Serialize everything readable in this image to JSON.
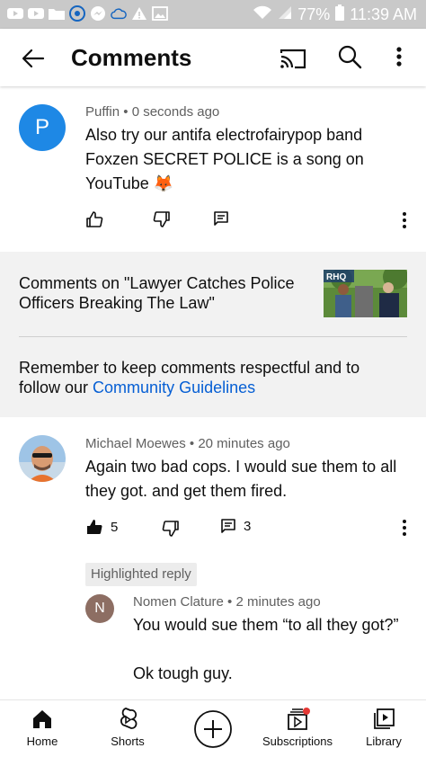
{
  "status_bar": {
    "battery": "77%",
    "time": "11:39 AM"
  },
  "app_bar": {
    "title": "Comments",
    "icons": [
      "back-arrow-icon",
      "cast-icon",
      "search-icon",
      "more-vert-icon"
    ]
  },
  "comments": [
    {
      "author": "Puffin",
      "time": "0 seconds ago",
      "avatar_letter": "P",
      "avatar_color": "#1e88e5",
      "text": "Also try our antifa electrofairypop band Foxzen SECRET POLICE is a song on YouTube 🦊"
    }
  ],
  "video_info": {
    "title": "Comments on \"Lawyer Catches Police Officers Breaking The Law\"",
    "thumb_badge": "RHQ",
    "reminder_prefix": "Remember to keep comments respectful and to follow our ",
    "reminder_link": "Community Guidelines"
  },
  "second_comment": {
    "author": "Michael Moewes",
    "time": "20 minutes ago",
    "text": "Again two bad cops. I would sue them to all they got. and get them fired.",
    "likes": "5",
    "replies": "3"
  },
  "highlighted_label": "Highlighted reply",
  "reply": {
    "author": "Nomen Clature",
    "time": "2 minutes ago",
    "avatar_letter": "N",
    "avatar_color": "#8d6e63",
    "text_line1": "You would sue them “to all they got?”",
    "text_line2": "Ok tough guy."
  },
  "bottom_nav": [
    {
      "label": "Home",
      "icon": "home-icon"
    },
    {
      "label": "Shorts",
      "icon": "shorts-icon"
    },
    {
      "label": "",
      "icon": "create-plus-icon"
    },
    {
      "label": "Subscriptions",
      "icon": "subscriptions-icon"
    },
    {
      "label": "Library",
      "icon": "library-icon"
    }
  ],
  "colors": {
    "accent_link": "#065fd4",
    "notification_dot": "#e53935"
  },
  "separator": " • "
}
